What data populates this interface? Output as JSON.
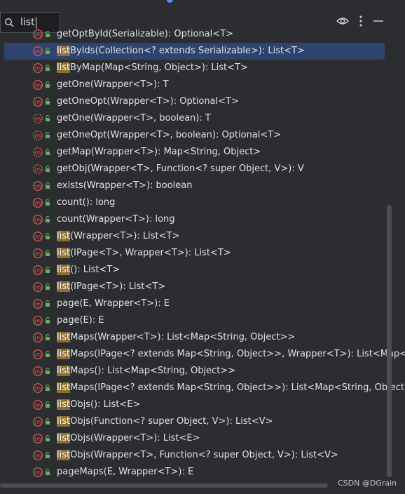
{
  "search": {
    "query": "list"
  },
  "methods": [
    {
      "prefix": "",
      "rest": "getOptById(Serializable): Optional<T>",
      "icon": "method",
      "selected": false
    },
    {
      "prefix": "list",
      "rest": "ByIds(Collection<? extends Serializable>): List<T>",
      "icon": "method",
      "selected": true
    },
    {
      "prefix": "list",
      "rest": "ByMap(Map<String, Object>): List<T>",
      "icon": "method",
      "selected": false
    },
    {
      "prefix": "",
      "rest": "getOne(Wrapper<T>): T",
      "icon": "method",
      "selected": false
    },
    {
      "prefix": "",
      "rest": "getOneOpt(Wrapper<T>): Optional<T>",
      "icon": "method",
      "selected": false
    },
    {
      "prefix": "",
      "rest": "getOne(Wrapper<T>, boolean): T",
      "icon": "method-abstract",
      "selected": false
    },
    {
      "prefix": "",
      "rest": "getOneOpt(Wrapper<T>, boolean): Optional<T>",
      "icon": "method-abstract",
      "selected": false
    },
    {
      "prefix": "",
      "rest": "getMap(Wrapper<T>): Map<String, Object>",
      "icon": "method-abstract",
      "selected": false
    },
    {
      "prefix": "",
      "rest": "getObj(Wrapper<T>, Function<? super Object, V>): V",
      "icon": "method-abstract",
      "selected": false
    },
    {
      "prefix": "",
      "rest": "exists(Wrapper<T>): boolean",
      "icon": "method",
      "selected": false
    },
    {
      "prefix": "",
      "rest": "count(): long",
      "icon": "method",
      "selected": false
    },
    {
      "prefix": "",
      "rest": "count(Wrapper<T>): long",
      "icon": "method",
      "selected": false
    },
    {
      "prefix": "list",
      "rest": "(Wrapper<T>): List<T>",
      "icon": "method",
      "selected": false
    },
    {
      "prefix": "list",
      "rest": "(IPage<T>, Wrapper<T>): List<T>",
      "icon": "method",
      "selected": false
    },
    {
      "prefix": "list",
      "rest": "(): List<T>",
      "icon": "method",
      "selected": false
    },
    {
      "prefix": "list",
      "rest": "(IPage<T>): List<T>",
      "icon": "method",
      "selected": false
    },
    {
      "prefix": "",
      "rest": "page(E, Wrapper<T>): E",
      "icon": "method",
      "selected": false
    },
    {
      "prefix": "",
      "rest": "page(E): E",
      "icon": "method",
      "selected": false
    },
    {
      "prefix": "list",
      "rest": "Maps(Wrapper<T>): List<Map<String, Object>>",
      "icon": "method",
      "selected": false
    },
    {
      "prefix": "list",
      "rest": "Maps(IPage<? extends Map<String, Object>>, Wrapper<T>): List<Map<S",
      "icon": "method",
      "selected": false
    },
    {
      "prefix": "list",
      "rest": "Maps(): List<Map<String, Object>>",
      "icon": "method",
      "selected": false
    },
    {
      "prefix": "list",
      "rest": "Maps(IPage<? extends Map<String, Object>>): List<Map<String, Object>",
      "icon": "method",
      "selected": false
    },
    {
      "prefix": "list",
      "rest": "Objs(): List<E>",
      "icon": "method",
      "selected": false
    },
    {
      "prefix": "list",
      "rest": "Objs(Function<? super Object, V>): List<V>",
      "icon": "method",
      "selected": false
    },
    {
      "prefix": "list",
      "rest": "Objs(Wrapper<T>): List<E>",
      "icon": "method",
      "selected": false
    },
    {
      "prefix": "list",
      "rest": "Objs(Wrapper<T>, Function<? super Object, V>): List<V>",
      "icon": "method",
      "selected": false
    },
    {
      "prefix": "",
      "rest": "pageMaps(E, Wrapper<T>): E",
      "icon": "method",
      "selected": false
    }
  ],
  "watermark": "CSDN @DGrain",
  "colors": {
    "background": "#2b2d30",
    "selection": "#2e436e",
    "match_highlight": "#8e6f2c",
    "method_icon": "#d9534f",
    "lock_icon": "#5fb25f"
  }
}
